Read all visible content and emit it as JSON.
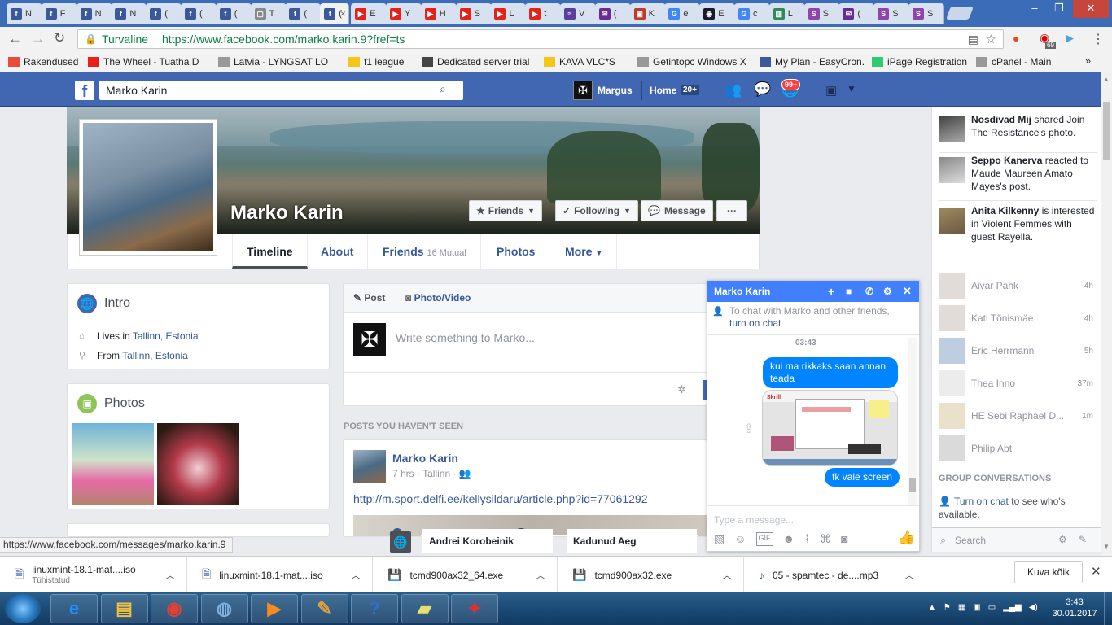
{
  "browser": {
    "tabs": [
      {
        "label": "N",
        "color": "#3b5998",
        "glyph": "f"
      },
      {
        "label": "F",
        "color": "#3b5998",
        "glyph": "f"
      },
      {
        "label": "N",
        "color": "#3b5998",
        "glyph": "f"
      },
      {
        "label": "N",
        "color": "#3b5998",
        "glyph": "f"
      },
      {
        "label": "(",
        "color": "#3b5998",
        "glyph": "f"
      },
      {
        "label": "(",
        "color": "#3b5998",
        "glyph": "f"
      },
      {
        "label": "(",
        "color": "#3b5998",
        "glyph": "f"
      },
      {
        "label": "T",
        "color": "#888888",
        "glyph": "▢"
      },
      {
        "label": "(",
        "color": "#3b5998",
        "glyph": "f"
      },
      {
        "label": "(",
        "color": "#3b5998",
        "glyph": "f",
        "active": true
      },
      {
        "label": "E",
        "color": "#e62117",
        "glyph": "▶"
      },
      {
        "label": "Y",
        "color": "#e62117",
        "glyph": "▶"
      },
      {
        "label": "H",
        "color": "#e62117",
        "glyph": "▶"
      },
      {
        "label": "S",
        "color": "#e62117",
        "glyph": "▶"
      },
      {
        "label": "L",
        "color": "#e62117",
        "glyph": "▶"
      },
      {
        "label": "t",
        "color": "#e62117",
        "glyph": "▶"
      },
      {
        "label": "V",
        "color": "#5a3e9b",
        "glyph": "≈"
      },
      {
        "label": "(",
        "color": "#6b2c91",
        "glyph": "✉"
      },
      {
        "label": "K",
        "color": "#c0392b",
        "glyph": "▣"
      },
      {
        "label": "e",
        "color": "#4285f4",
        "glyph": "G"
      },
      {
        "label": "E",
        "color": "#1a1a2e",
        "glyph": "◉"
      },
      {
        "label": "c",
        "color": "#4285f4",
        "glyph": "G"
      },
      {
        "label": "L",
        "color": "#2e8b57",
        "glyph": "▥"
      },
      {
        "label": "S",
        "color": "#8e44ad",
        "glyph": "S"
      },
      {
        "label": "(",
        "color": "#6b2c91",
        "glyph": "✉"
      },
      {
        "label": "S",
        "color": "#8e44ad",
        "glyph": "S"
      },
      {
        "label": "S",
        "color": "#8e44ad",
        "glyph": "S"
      }
    ],
    "secure_label": "Turvaline",
    "url": "https://www.facebook.com/marko.karin.9?fref=ts",
    "ext_badge": "69",
    "bookmarks": [
      {
        "label": "Rakendused",
        "color": "#e74c3c"
      },
      {
        "label": "The Wheel - Tuatha D",
        "color": "#e62117"
      },
      {
        "label": "Latvia - LYNGSAT LO",
        "color": "#999999"
      },
      {
        "label": "f1 league",
        "color": "#f5c518"
      },
      {
        "label": "Dedicated server trial",
        "color": "#444444"
      },
      {
        "label": "KAVA VLC*S",
        "color": "#f5c518"
      },
      {
        "label": "Getintopc Windows X",
        "color": "#999999"
      },
      {
        "label": "My Plan - EasyCron.cc",
        "color": "#3b5998"
      },
      {
        "label": "iPage Registration",
        "color": "#2ecc71"
      },
      {
        "label": "cPanel - Main",
        "color": "#999999"
      }
    ],
    "bookmarks_more": "»",
    "status_url": "https://www.facebook.com/messages/marko.karin.9"
  },
  "fb_header": {
    "search_value": "Marko Karin",
    "user_name": "Margus",
    "home_label": "Home",
    "home_count": "20+",
    "notif_badge": "99+"
  },
  "profile": {
    "name": "Marko Karin",
    "btn_friends": "Friends",
    "btn_following": "Following",
    "btn_message": "Message",
    "btn_more": "···",
    "nav": {
      "timeline": "Timeline",
      "about": "About",
      "friends": "Friends",
      "mutual": "16 Mutual",
      "photos": "Photos",
      "more": "More"
    }
  },
  "intro": {
    "title": "Intro",
    "lives_prefix": "Lives in",
    "lives_link": "Tallinn, Estonia",
    "from_prefix": "From",
    "from_link": "Tallinn, Estonia"
  },
  "photos_card": {
    "title": "Photos"
  },
  "composer": {
    "post_tab": "Post",
    "photo_tab": "Photo/Video",
    "placeholder": "Write something to Marko..."
  },
  "feed": {
    "section_title": "POSTS YOU HAVEN'T SEEN",
    "post_author": "Marko Karin",
    "post_meta": "7 hrs · Tallinn ·",
    "post_link": "http://m.sport.delfi.ee/kellysildaru/article.php?id=77061292",
    "preview_name1": "Andrei Korobeinik",
    "preview_name2": "Kadunud Aeg"
  },
  "ticker": {
    "items": [
      {
        "name": "Nosdivad Mij",
        "text": "shared Join The Resistance's photo."
      },
      {
        "name": "Seppo Kanerva",
        "text": "reacted to Maude Maureen Amato Mayes's post."
      },
      {
        "name": "Anita Kilkenny",
        "text": "is interested in Violent Femmes with guest Rayella."
      }
    ],
    "contacts": [
      {
        "name": "Aivar Pahk",
        "time": "4h"
      },
      {
        "name": "Kati Tõnismäe",
        "time": "4h"
      },
      {
        "name": "Eric Herrmann",
        "time": "5h"
      },
      {
        "name": "Thea Inno",
        "time": "37m"
      },
      {
        "name": "HE Sebi Raphael D...",
        "time": "1m"
      },
      {
        "name": "Philip Abt",
        "time": ""
      }
    ],
    "group_title": "GROUP CONVERSATIONS",
    "turn_on_link": "Turn on chat",
    "turn_on_rest": "to see who's available.",
    "search_placeholder": "Search"
  },
  "chat": {
    "title": "Marko Karin",
    "notice_text": "To chat with Marko and other friends,",
    "notice_link": "turn on chat",
    "time": "03:43",
    "msg1": "kui ma rikkaks saan annan teada",
    "msg2": "fk vale screen",
    "input_placeholder": "Type a message..."
  },
  "downloads": {
    "items": [
      {
        "name": "linuxmint-18.1-mat....iso",
        "sub": "Tühistatud"
      },
      {
        "name": "linuxmint-18.1-mat....iso",
        "sub": ""
      },
      {
        "name": "tcmd900ax32_64.exe",
        "sub": ""
      },
      {
        "name": "tcmd900ax32.exe",
        "sub": ""
      },
      {
        "name": "05 - spamtec - de....mp3",
        "sub": ""
      }
    ],
    "show_all": "Kuva kõik"
  },
  "taskbar": {
    "time": "3:43",
    "date": "30.01.2017"
  }
}
